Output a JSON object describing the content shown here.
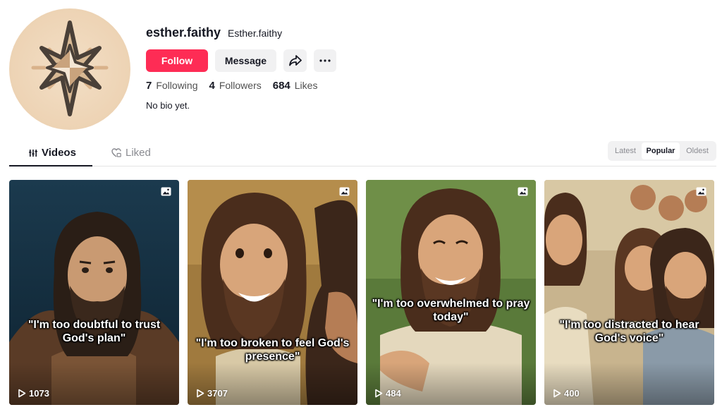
{
  "profile": {
    "username": "esther.faithy",
    "nickname": "Esther.faithy",
    "follow_label": "Follow",
    "message_label": "Message",
    "bio": "No bio yet.",
    "stats": {
      "following_count": "7",
      "following_label": "Following",
      "followers_count": "4",
      "followers_label": "Followers",
      "likes_count": "684",
      "likes_label": "Likes"
    }
  },
  "tabs": {
    "videos_label": "Videos",
    "liked_label": "Liked"
  },
  "sort": {
    "options": [
      "Latest",
      "Popular",
      "Oldest"
    ],
    "selected": "Popular"
  },
  "videos": [
    {
      "caption": "\"I'm too doubtful to trust God's plan\"",
      "plays": "1073"
    },
    {
      "caption": "\"I'm too broken to feel God's presence\"",
      "plays": "3707"
    },
    {
      "caption": "\"I'm too overwhelmed to pray today\"",
      "plays": "484"
    },
    {
      "caption": "\"I'm too distracted to hear God's voice\"",
      "plays": "400"
    }
  ],
  "colors": {
    "accent": "#fe2c55",
    "text": "#161823",
    "muted": "#8a8b91",
    "button_bg": "#f1f1f2"
  }
}
